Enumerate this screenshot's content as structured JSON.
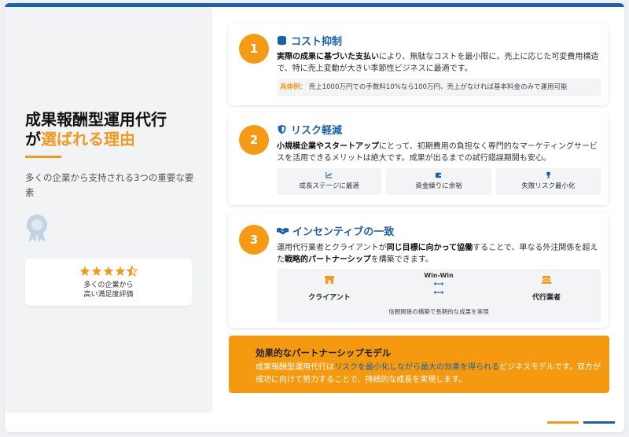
{
  "colors": {
    "accent_orange": "#f29a1f",
    "brand_blue": "#1f5fa8",
    "panel_gray": "#f2f3f5"
  },
  "hero": {
    "title_line1": "成果報酬型運用代行",
    "title_prefix": "が",
    "title_highlight": "選ばれる理由",
    "subtitle": "多くの企業から支持される3つの重要な要素",
    "award_icon": "award-ribbon-icon",
    "rating": {
      "stars": 4.5,
      "text_line1": "多くの企業から",
      "text_line2": "高い満足度評価"
    }
  },
  "reasons": [
    {
      "number": "1",
      "icon": "coins-icon",
      "title": "コスト抑制",
      "body_bold": "実際の成果に基づいた支払い",
      "body_rest": "により、無駄なコストを最小限に。売上に応じた可変費用構造で、特に売上変動が大きい季節性ビジネスに最適です。",
      "example_label": "具体例：",
      "example_text": "売上1000万円での手数料10%なら100万円、売上がなければ基本料金のみで運用可能"
    },
    {
      "number": "2",
      "icon": "shield-icon",
      "title": "リスク軽減",
      "body_bold": "小規模企業やスタートアップ",
      "body_rest": "にとって、初期費用の負担なく専門的なマーケティングサービスを活用できるメリットは絶大です。成果が出るまでの試行錯誤期間も安心。",
      "features": [
        {
          "icon": "chart-line-icon",
          "label": "成長ステージに最適"
        },
        {
          "icon": "wallet-icon",
          "label": "資金繰りに余裕"
        },
        {
          "icon": "trophy-icon",
          "label": "失敗リスク最小化"
        }
      ]
    },
    {
      "number": "3",
      "icon": "handshake-icon",
      "title": "インセンティブの一致",
      "body_part1": "運用代行業者とクライアントが",
      "body_bold1": "同じ目標に向かって協働",
      "body_part2": "することで、単なる外注関係を超えた",
      "body_bold2": "戦略的パートナーシップ",
      "body_part3": "を構築できます。",
      "partner": {
        "left_icon": "store-icon",
        "left_label": "クライアント",
        "middle_label": "Win-Win",
        "right_icon": "laptop-code-icon",
        "right_label": "代行業者",
        "note": "信頼関係の構築で長期的な成果を実現"
      }
    }
  ],
  "summary": {
    "title": "効果的なパートナーシップモデル",
    "text_part1": "成果報酬型運用代行は",
    "text_highlight": "リスクを最小化しながら最大の効果を得られる",
    "text_part2": "ビジネスモデルです。双方が成功に向けて努力することで、持続的な成長を実現します。"
  }
}
